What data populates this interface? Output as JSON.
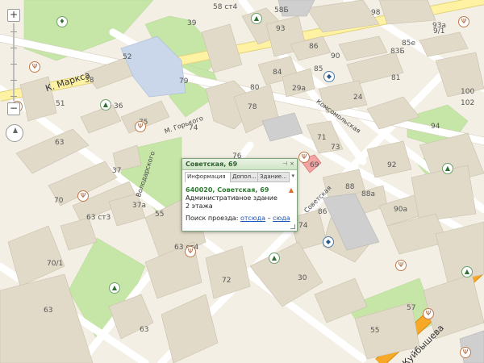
{
  "popup": {
    "title": "Советская, 69",
    "tabs": [
      "Информация",
      "Допол...",
      "Здание..."
    ],
    "tab_overflow_arrow": "chevron-down-icon",
    "postcode_address": "640020, Советская, 69",
    "building_type": "Административное здание",
    "floors": "2 этажа",
    "route_label": "Поиск проезда:",
    "route_from": "отсюда",
    "route_dash": "–",
    "route_to": "сюда",
    "warning_icon": "warning-icon"
  },
  "map": {
    "controls": {
      "zoom_in": "+",
      "zoom_out": "−"
    },
    "streets": [
      "К. Маркса",
      "М. Горького",
      "Комсомольская",
      "Володарского",
      "Советская",
      "Куйбышева"
    ],
    "house_numbers": [
      "58 ст4",
      "58Б",
      "98",
      "39",
      "93",
      "93а",
      "9/1",
      "52",
      "85е",
      "86",
      "90",
      "83Б",
      "38",
      "84",
      "85",
      "79",
      "81",
      "51",
      "36",
      "75",
      "80",
      "29а",
      "24",
      "100",
      "102",
      "78",
      "63",
      "74",
      "71",
      "73",
      "94",
      "76",
      "69",
      "92",
      "37",
      "70",
      "88",
      "88а",
      "86",
      "90а",
      "63 ст3",
      "37а",
      "74",
      "70/1",
      "63 ст4",
      "55",
      "72",
      "30",
      "63",
      "57",
      "55",
      "63"
    ],
    "colors": {
      "background": "#f3efe5",
      "buildings": "#e1dac9",
      "parks": "#c6e6a8",
      "main_road": "#fff3a3",
      "highway": "#f7a827",
      "selected_building": "#f2a3a3"
    }
  }
}
